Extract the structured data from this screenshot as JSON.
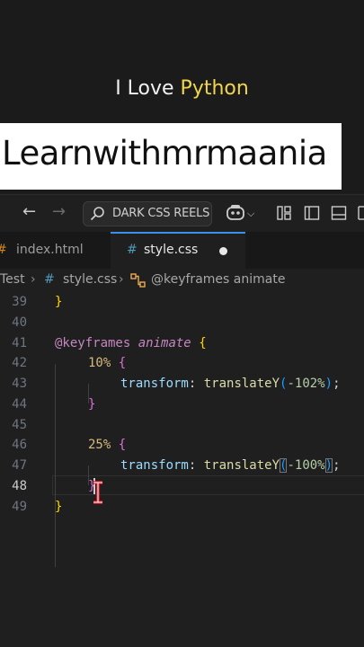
{
  "overlay": {
    "caption_prefix": "I Love ",
    "caption_highlight": "Python",
    "banner": "Learnwithmrmaania"
  },
  "titlebar": {
    "search_text": "DARK CSS REELS"
  },
  "tabs": [
    {
      "label": "index.html",
      "hash": "#"
    },
    {
      "label": "style.css",
      "hash": "#"
    }
  ],
  "breadcrumb": {
    "folder": "Test",
    "file": "style.css",
    "symbol": "@keyframes animate"
  },
  "editor": {
    "line_numbers": [
      "39",
      "40",
      "41",
      "42",
      "43",
      "44",
      "45",
      "46",
      "47",
      "48",
      "49"
    ],
    "active_line": "48",
    "lines": {
      "l39": "}",
      "l41_kw": "@keyframes",
      "l41_name": "animate",
      "l41_brace": "{",
      "l42_sel": "10%",
      "l42_brace": "{",
      "l43_prop": "transform",
      "l43_colon": ":",
      "l43_fn": "translateY",
      "l43_open": "(",
      "l43_val": "-102%",
      "l43_close": ")",
      "l43_semi": ";",
      "l44_brace": "}",
      "l46_sel": "25%",
      "l46_brace": "{",
      "l47_prop": "transform",
      "l47_colon": ":",
      "l47_fn": "translateY",
      "l47_open": "(",
      "l47_val": "-100%",
      "l47_close": ")",
      "l47_semi": ";",
      "l48_brace": "}",
      "l49": "}"
    }
  },
  "colors": {
    "accent": "#3b8eea",
    "caption_highlight": "#f0d64a"
  }
}
